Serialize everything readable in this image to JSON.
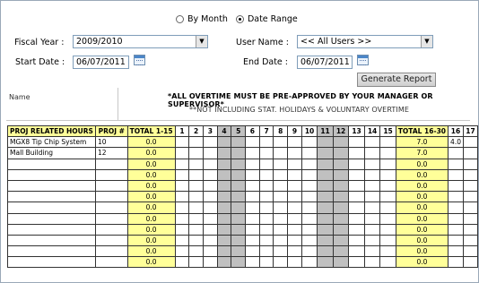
{
  "filters": {
    "mode_by_month": "By Month",
    "mode_date_range": "Date Range",
    "fiscal_year_label": "Fiscal Year :",
    "fiscal_year_value": "2009/2010",
    "user_name_label": "User Name :",
    "user_name_value": "<< All Users >>",
    "start_date_label": "Start Date :",
    "start_date_value": "06/07/2011",
    "end_date_label": "End Date :",
    "end_date_value": "06/07/2011",
    "generate_label": "Generate Report"
  },
  "notices": {
    "name_header": "Name",
    "line1": "*ALL OVERTIME MUST BE PRE-APPROVED BY YOUR MANAGER OR SUPERVISOR*",
    "line2": "**NOT INCLUDING STAT. HOLIDAYS & VOLUNTARY OVERTIME"
  },
  "table": {
    "headers": {
      "proj_related": "PROJ RELATED HOURS",
      "proj_num": "PROJ #",
      "total_1_15": "TOTAL 1-15",
      "days_first": [
        "1",
        "2",
        "3",
        "4",
        "5",
        "6",
        "7",
        "8",
        "9",
        "10",
        "11",
        "12",
        "13",
        "14",
        "15"
      ],
      "total_16_30": "TOTAL 16-30",
      "days_second": [
        "16",
        "17"
      ]
    },
    "rows": [
      {
        "name": "MGX8 Tip Chip System",
        "proj": "10",
        "total1": "0.0",
        "total2": "7.0",
        "d16": "4.0",
        "d17": ""
      },
      {
        "name": "Mall Building",
        "proj": "12",
        "total1": "0.0",
        "total2": "7.0",
        "d16": "",
        "d17": ""
      },
      {
        "name": "",
        "proj": "",
        "total1": "0.0",
        "total2": "0.0",
        "d16": "",
        "d17": ""
      },
      {
        "name": "",
        "proj": "",
        "total1": "0.0",
        "total2": "0.0",
        "d16": "",
        "d17": ""
      },
      {
        "name": "",
        "proj": "",
        "total1": "0.0",
        "total2": "0.0",
        "d16": "",
        "d17": ""
      },
      {
        "name": "",
        "proj": "",
        "total1": "0.0",
        "total2": "0.0",
        "d16": "",
        "d17": ""
      },
      {
        "name": "",
        "proj": "",
        "total1": "0.0",
        "total2": "0.0",
        "d16": "",
        "d17": ""
      },
      {
        "name": "",
        "proj": "",
        "total1": "0.0",
        "total2": "0.0",
        "d16": "",
        "d17": ""
      },
      {
        "name": "",
        "proj": "",
        "total1": "0.0",
        "total2": "0.0",
        "d16": "",
        "d17": ""
      },
      {
        "name": "",
        "proj": "",
        "total1": "0.0",
        "total2": "0.0",
        "d16": "",
        "d17": ""
      },
      {
        "name": "",
        "proj": "",
        "total1": "0.0",
        "total2": "0.0",
        "d16": "",
        "d17": ""
      },
      {
        "name": "",
        "proj": "",
        "total1": "0.0",
        "total2": "0.0",
        "d16": "",
        "d17": ""
      }
    ],
    "weekend_days": [
      "4",
      "5",
      "11",
      "12"
    ]
  },
  "colors": {
    "total_highlight": "#ffff99",
    "weekend_shade": "#c0c0c0"
  }
}
